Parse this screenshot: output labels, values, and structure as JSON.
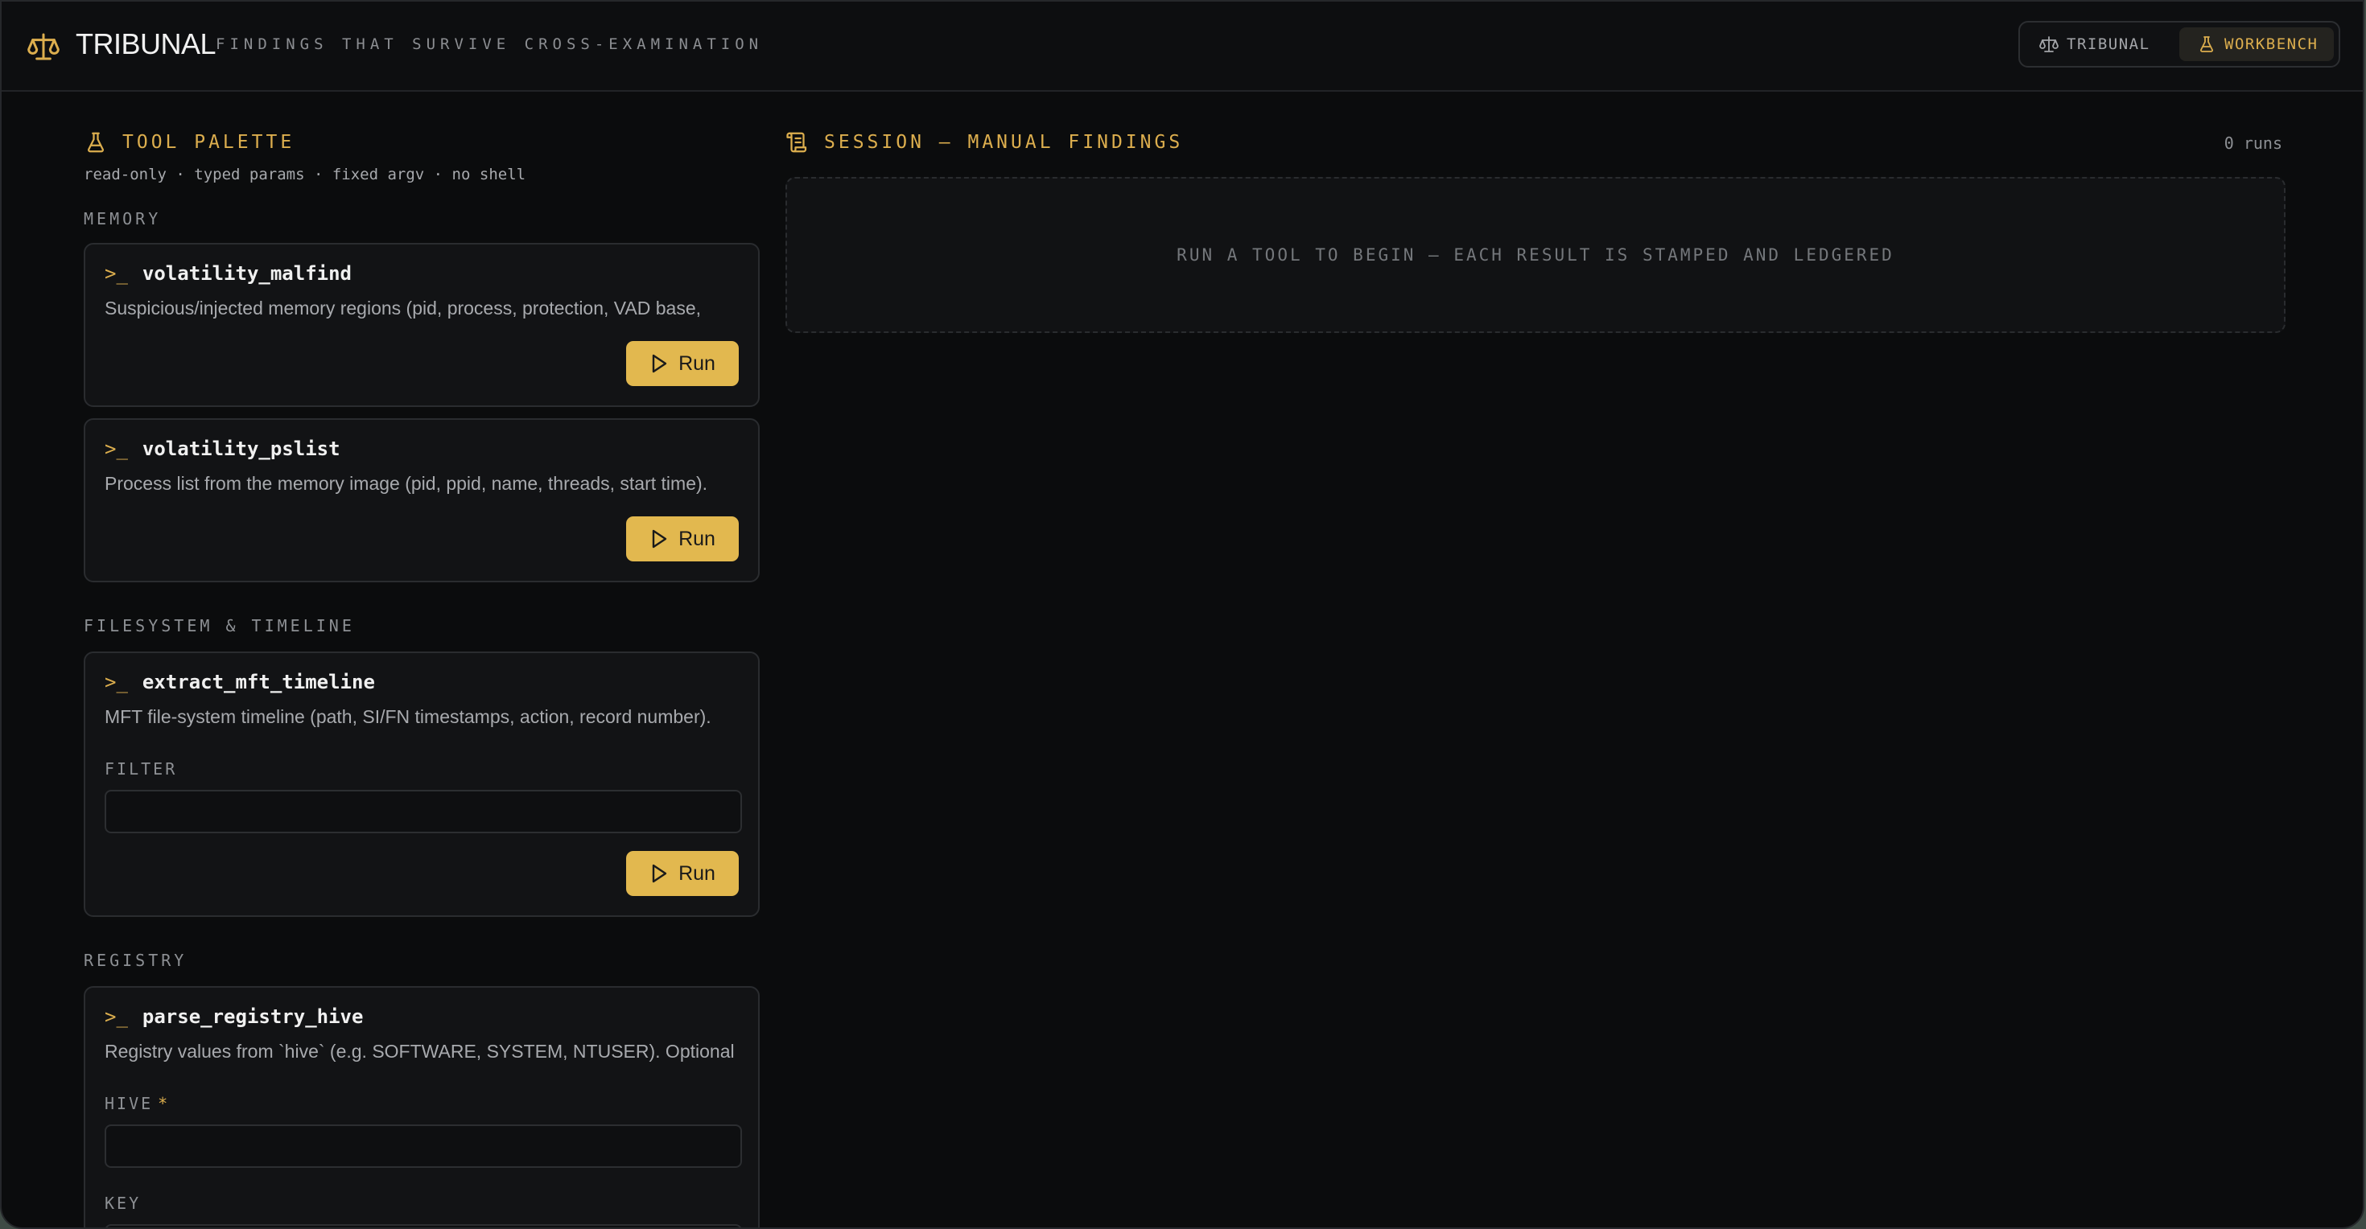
{
  "header": {
    "app_name": "TRIBUNAL",
    "tagline": "FINDINGS THAT SURVIVE CROSS-EXAMINATION",
    "modes": [
      {
        "label": "TRIBUNAL",
        "icon": "scales-icon",
        "active": false
      },
      {
        "label": "WORKBENCH",
        "icon": "flask-icon",
        "active": true
      }
    ]
  },
  "palette": {
    "title": "TOOL PALETTE",
    "subtitle": "read-only · typed params · fixed argv · no shell",
    "groups": [
      {
        "label": "MEMORY",
        "tools": [
          {
            "name": "volatility_malfind",
            "description": "Suspicious/injected memory regions (pid, process, protection, VAD base,",
            "run_label": "Run"
          },
          {
            "name": "volatility_pslist",
            "description": "Process list from the memory image (pid, ppid, name, threads, start time).",
            "run_label": "Run"
          }
        ]
      },
      {
        "label": "FILESYSTEM & TIMELINE",
        "tools": [
          {
            "name": "extract_mft_timeline",
            "description": "MFT file-system timeline (path, SI/FN timestamps, action, record number).",
            "params": [
              {
                "label": "FILTER",
                "required": false,
                "value": ""
              }
            ],
            "run_label": "Run"
          }
        ]
      },
      {
        "label": "REGISTRY",
        "tools": [
          {
            "name": "parse_registry_hive",
            "description": "Registry values from `hive` (e.g. SOFTWARE, SYSTEM, NTUSER). Optional",
            "params": [
              {
                "label": "HIVE",
                "required": true,
                "required_mark": "*",
                "value": ""
              },
              {
                "label": "KEY",
                "required": false,
                "value": ""
              }
            ]
          }
        ]
      }
    ]
  },
  "session": {
    "title": "SESSION — MANUAL FINDINGS",
    "runs": "0 runs",
    "empty_message": "RUN A TOOL TO BEGIN — EACH RESULT IS STAMPED AND LEDGERED"
  },
  "colors": {
    "accent": "#e2b84f",
    "accent_text": "#dcae4e",
    "background": "#0b0c0d",
    "card": "#121315"
  }
}
